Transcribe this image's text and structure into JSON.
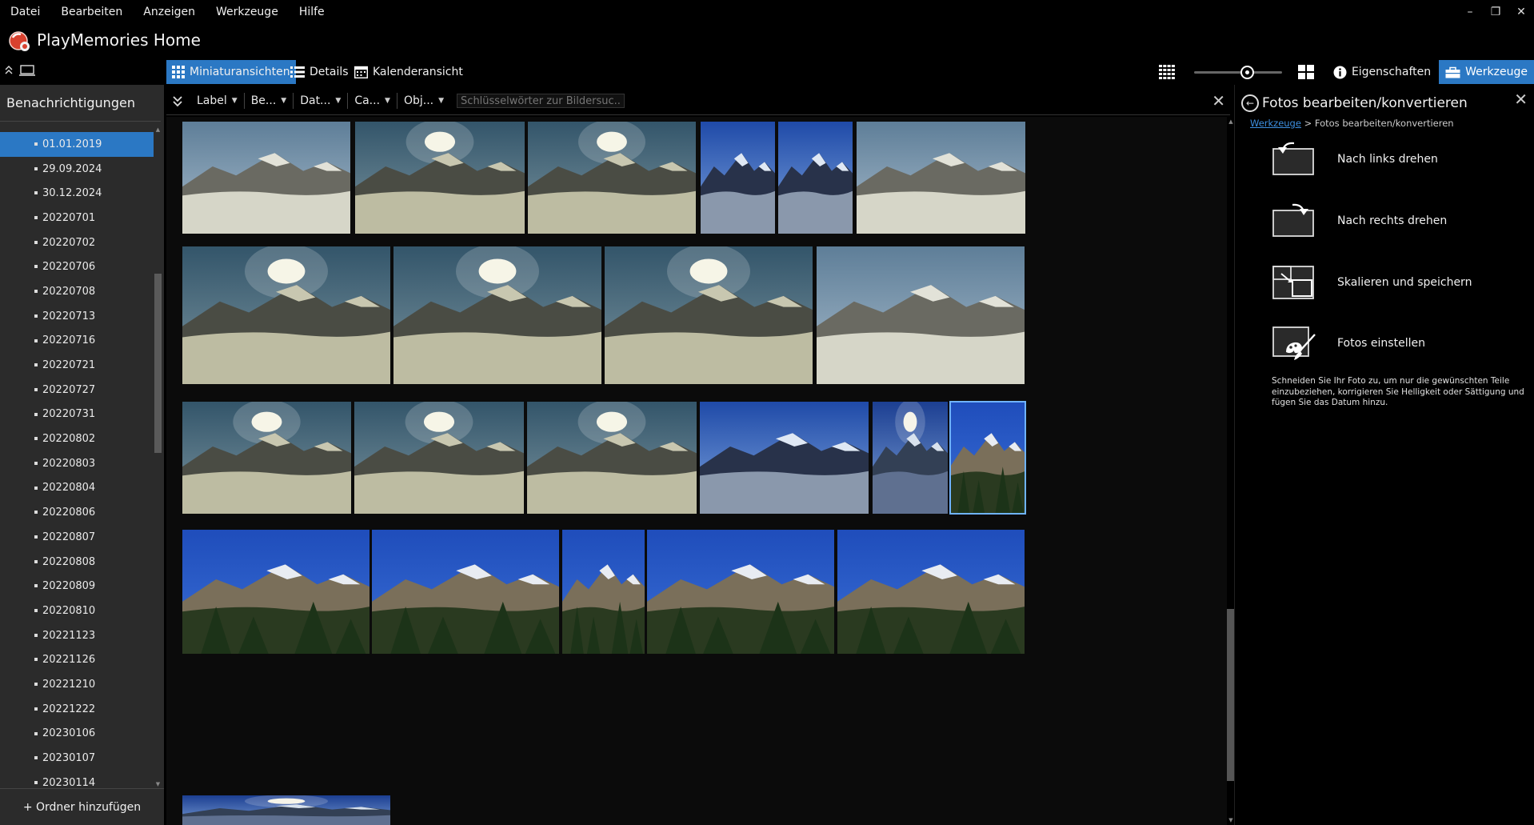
{
  "menu": [
    "Datei",
    "Bearbeiten",
    "Anzeigen",
    "Werkzeuge",
    "Hilfe"
  ],
  "window_controls": {
    "minimize": "–",
    "restore": "❐",
    "close": "✕"
  },
  "app": {
    "title": "PlayMemories Home"
  },
  "viewbar": {
    "tab_thumbnails": "Miniaturansichten",
    "tab_details": "Details",
    "tab_calendar": "Kalenderansicht",
    "thumbnail_size_level": 0.62,
    "properties_label": "Eigenschaften",
    "tools_label": "Werkzeuge"
  },
  "sidebar": {
    "header": "Benachrichtigungen",
    "items": [
      "01.01.2019",
      "29.09.2024",
      "30.12.2024",
      "20220701",
      "20220702",
      "20220706",
      "20220708",
      "20220713",
      "20220716",
      "20220721",
      "20220727",
      "20220731",
      "20220802",
      "20220803",
      "20220804",
      "20220806",
      "20220807",
      "20220808",
      "20220809",
      "20220810",
      "20221123",
      "20221126",
      "20221210",
      "20221222",
      "20230106",
      "20230107",
      "20230114"
    ],
    "selected_index": 0,
    "footer": "+ Ordner hinzufügen"
  },
  "filter": {
    "items": [
      "Label",
      "Be...",
      "Dat...",
      "Ca...",
      "Obj..."
    ],
    "search_placeholder": "Schlüsselwörter zur Bildersuc...",
    "close": "✕"
  },
  "panel": {
    "title": "Fotos bearbeiten/konvertieren",
    "breadcrumb_link": "Werkzeuge",
    "breadcrumb_rest": " > Fotos bearbeiten/konvertieren",
    "close": "✕",
    "tools": [
      {
        "label": "Nach links drehen",
        "icon": "rotate-left-icon"
      },
      {
        "label": "Nach rechts drehen",
        "icon": "rotate-right-icon"
      },
      {
        "label": "Skalieren und speichern",
        "icon": "resize-icon"
      },
      {
        "label": "Fotos einstellen",
        "icon": "adjust-photo-icon"
      }
    ],
    "description": "Schneiden Sie Ihr Foto zu, um nur die gewünschten Teile einzubeziehen, korrigieren Sie Helligkeit oder Sättigung und fügen Sie das Datum hinzu."
  },
  "colors": {
    "accent": "#2b78c4",
    "sidebar_bg": "#2b2b2b",
    "link": "#3d8fe0"
  }
}
